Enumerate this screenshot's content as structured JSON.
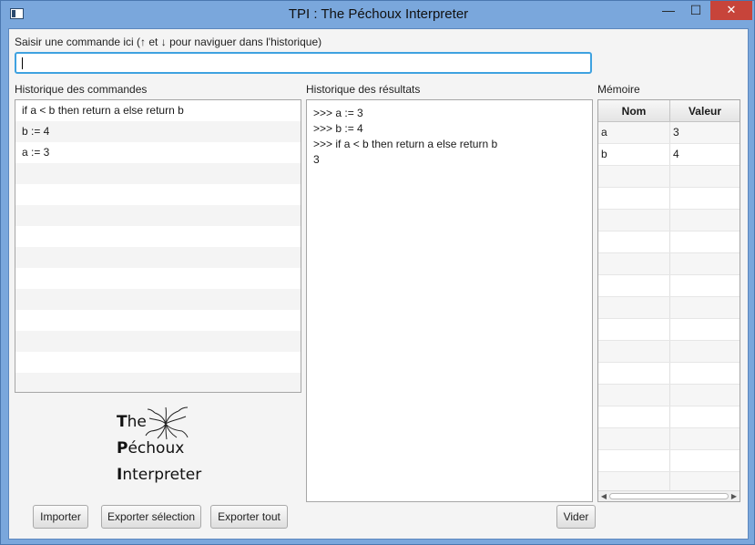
{
  "window": {
    "title": "TPI : The Péchoux Interpreter",
    "minimize": "—",
    "maximize": "☐",
    "close": "✕"
  },
  "input": {
    "label": "Saisir une commande ici (↑ et ↓ pour naviguer dans l'historique)",
    "value": ""
  },
  "commands": {
    "label": "Historique des commandes",
    "items": [
      "if a < b then return a else return b",
      "b := 4",
      "a := 3",
      "",
      "",
      "",
      "",
      "",
      "",
      "",
      "",
      "",
      "",
      ""
    ]
  },
  "results": {
    "label": "Historique des résultats",
    "lines": [
      ">>> a := 3",
      ">>> b := 4",
      ">>> if a < b then return a else return b",
      "3"
    ]
  },
  "memory": {
    "label": "Mémoire",
    "columns": [
      "Nom",
      "Valeur"
    ],
    "rows": [
      {
        "name": "a",
        "value": "3"
      },
      {
        "name": "b",
        "value": "4"
      }
    ]
  },
  "logo": {
    "line1_initial": "T",
    "line1_rest": "he",
    "line2_initial": "P",
    "line2_rest": "échoux",
    "line3_initial": "I",
    "line3_rest": "nterpreter"
  },
  "buttons": {
    "import": "Importer",
    "export_selection": "Exporter sélection",
    "export_all": "Exporter tout",
    "clear": "Vider"
  }
}
